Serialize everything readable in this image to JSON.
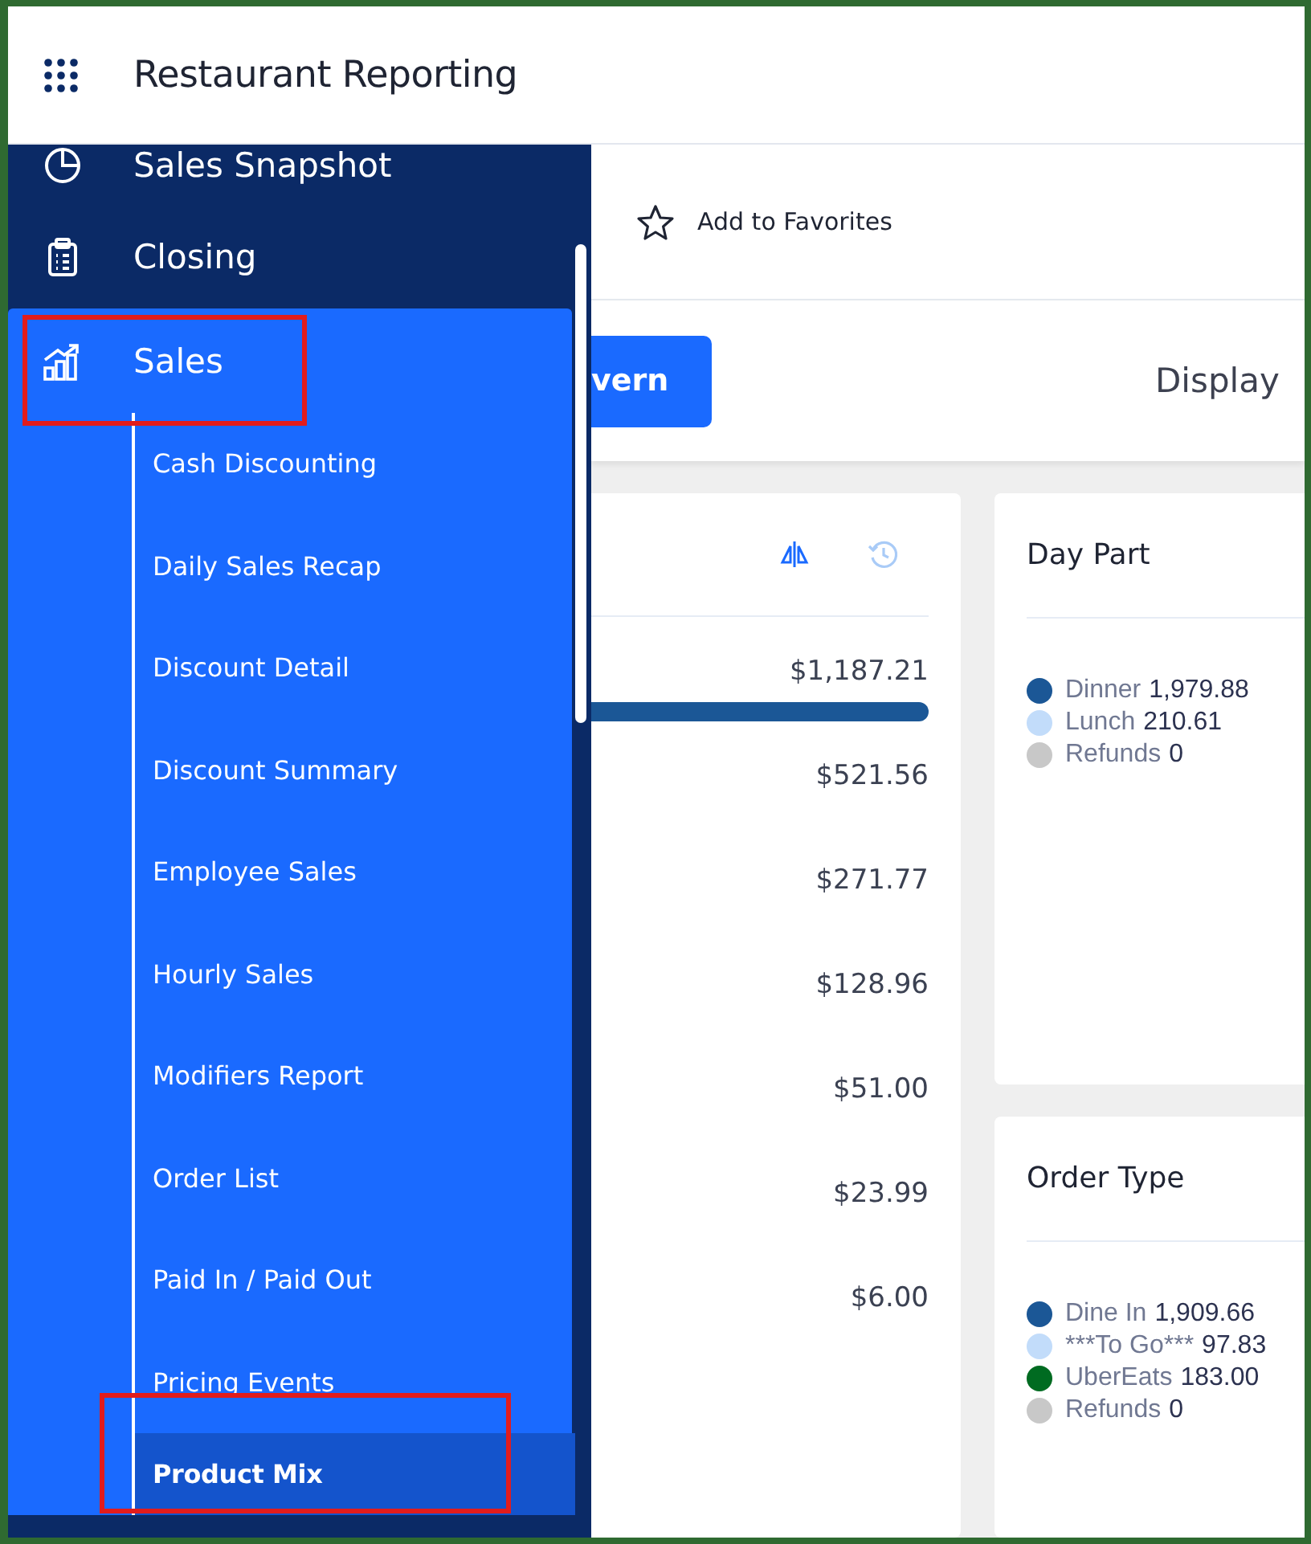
{
  "header": {
    "title": "Restaurant Reporting"
  },
  "sidebar": {
    "items": [
      {
        "label": "Sales Snapshot",
        "expanded": false,
        "annotated": false
      },
      {
        "label": "Closing",
        "expanded": false,
        "annotated": false
      },
      {
        "label": "Sales",
        "expanded": true,
        "annotated": true,
        "children": [
          {
            "label": "Cash Discounting",
            "selected": false,
            "annotated": false
          },
          {
            "label": "Daily Sales Recap",
            "selected": false,
            "annotated": false
          },
          {
            "label": "Discount Detail",
            "selected": false,
            "annotated": false
          },
          {
            "label": "Discount Summary",
            "selected": false,
            "annotated": false
          },
          {
            "label": "Employee Sales",
            "selected": false,
            "annotated": false
          },
          {
            "label": "Hourly Sales",
            "selected": false,
            "annotated": false
          },
          {
            "label": "Modifiers Report",
            "selected": false,
            "annotated": false
          },
          {
            "label": "Order List",
            "selected": false,
            "annotated": false
          },
          {
            "label": "Paid In / Paid Out",
            "selected": false,
            "annotated": false
          },
          {
            "label": "Pricing Events",
            "selected": false,
            "annotated": false
          },
          {
            "label": "Product Mix",
            "selected": true,
            "annotated": true
          }
        ]
      }
    ]
  },
  "toolbar": {
    "favorites": "Add to Favorites"
  },
  "band": {
    "button": "vern",
    "label": "Display"
  },
  "sales_card": {
    "rows": [
      {
        "value": "$1,187.21",
        "kind": "bar"
      },
      {
        "value": "$521.56",
        "kind": "plain"
      },
      {
        "value": "$271.77",
        "kind": "plain"
      },
      {
        "value": "$128.96",
        "kind": "plain"
      },
      {
        "value": "$51.00",
        "kind": "plain"
      },
      {
        "value": "$23.99",
        "kind": "plain"
      },
      {
        "value": "$6.00",
        "kind": "plain"
      }
    ]
  },
  "day_part": {
    "title": "Day Part",
    "legend": [
      {
        "name": "Dinner",
        "value": "1,979.88",
        "color": "#1b5796"
      },
      {
        "name": "Lunch",
        "value": "210.61",
        "color": "#c2dcfa"
      },
      {
        "name": "Refunds",
        "value": "0",
        "color": "#c8c8c8"
      }
    ]
  },
  "order_type": {
    "title": "Order Type",
    "legend": [
      {
        "name": "Dine In",
        "value": "1,909.66",
        "color": "#1b5796"
      },
      {
        "name": "***To Go***",
        "value": "97.83",
        "color": "#c2dcfa"
      },
      {
        "name": "UberEats",
        "value": "183.00",
        "color": "#006b21"
      },
      {
        "name": "Refunds",
        "value": "0",
        "color": "#c8c8c8"
      }
    ]
  }
}
